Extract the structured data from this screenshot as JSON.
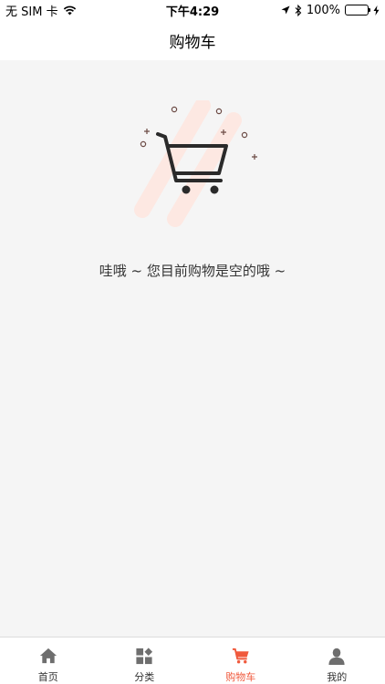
{
  "status_bar": {
    "carrier": "无 SIM 卡",
    "time": "下午4:29",
    "battery": "100%",
    "battery_level": 1.0,
    "icons": [
      "wifi-icon",
      "location-arrow-icon",
      "bluetooth-icon",
      "battery-icon",
      "charging-bolt-icon"
    ]
  },
  "header": {
    "title": "购物车"
  },
  "empty_state": {
    "illustration": "shopping-cart-icon",
    "message": "哇哦 ~ 您目前购物是空的哦 ~"
  },
  "tab_bar": {
    "active_color": "#f0593c",
    "items": [
      {
        "label": "首页",
        "icon": "home-icon"
      },
      {
        "label": "分类",
        "icon": "category-icon"
      },
      {
        "label": "购物车",
        "icon": "cart-icon",
        "active": true
      },
      {
        "label": "我的",
        "icon": "profile-icon"
      }
    ]
  }
}
